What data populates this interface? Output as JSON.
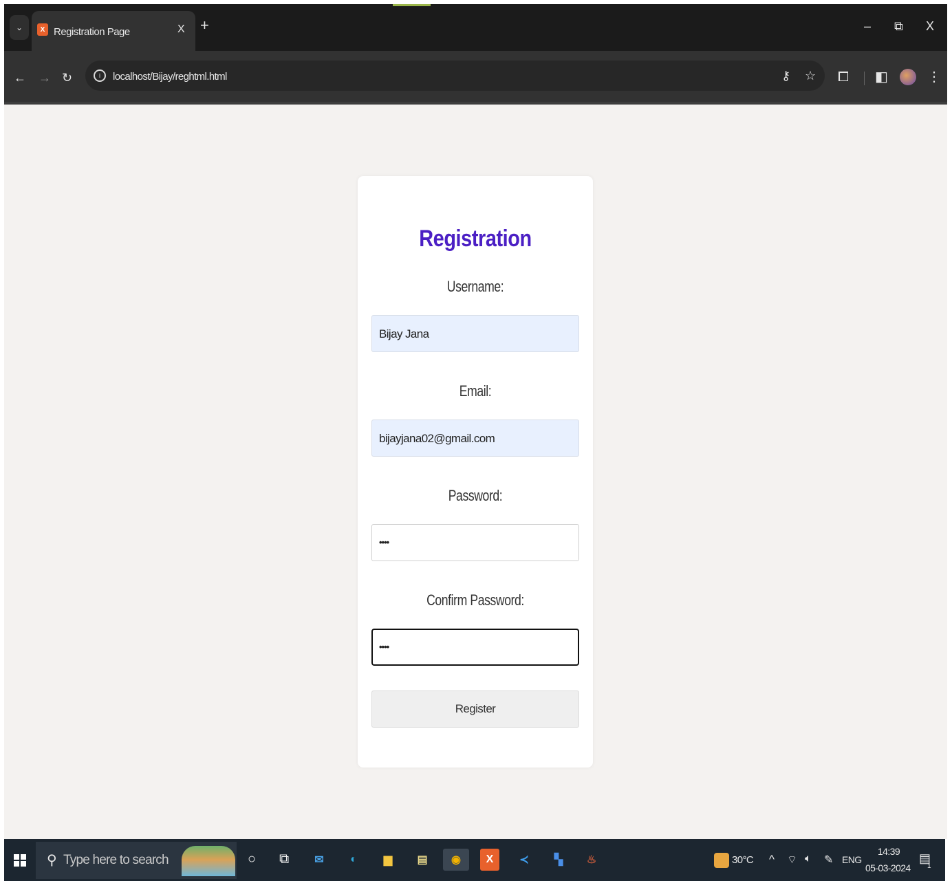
{
  "browser": {
    "tab_title": "Registration Page",
    "tab_close": "X",
    "new_tab": "+",
    "url": "localhost/Bijay/reghtml.html",
    "window_controls": {
      "minimize": "–",
      "restore": "⧉",
      "close": "X"
    }
  },
  "form": {
    "title": "Registration",
    "username_label": "Username:",
    "username_value": "Bijay Jana",
    "email_label": "Email:",
    "email_value": "bijayjana02@gmail.com",
    "password_label": "Password:",
    "password_masked": "••••",
    "confirm_label": "Confirm Password:",
    "confirm_masked": "••••",
    "register_label": "Register"
  },
  "taskbar": {
    "search_placeholder": "Type here to search",
    "temperature": "30°C",
    "language": "ENG",
    "time": "14:39",
    "date": "05-03-2024",
    "notification_count": "1"
  },
  "colors": {
    "title": "#4b1fc4",
    "page_bg": "#f4f2f0",
    "autofill_bg": "#e8f0fe",
    "chrome_bg": "#1f1f1f",
    "taskbar_bg": "#1c2630"
  }
}
